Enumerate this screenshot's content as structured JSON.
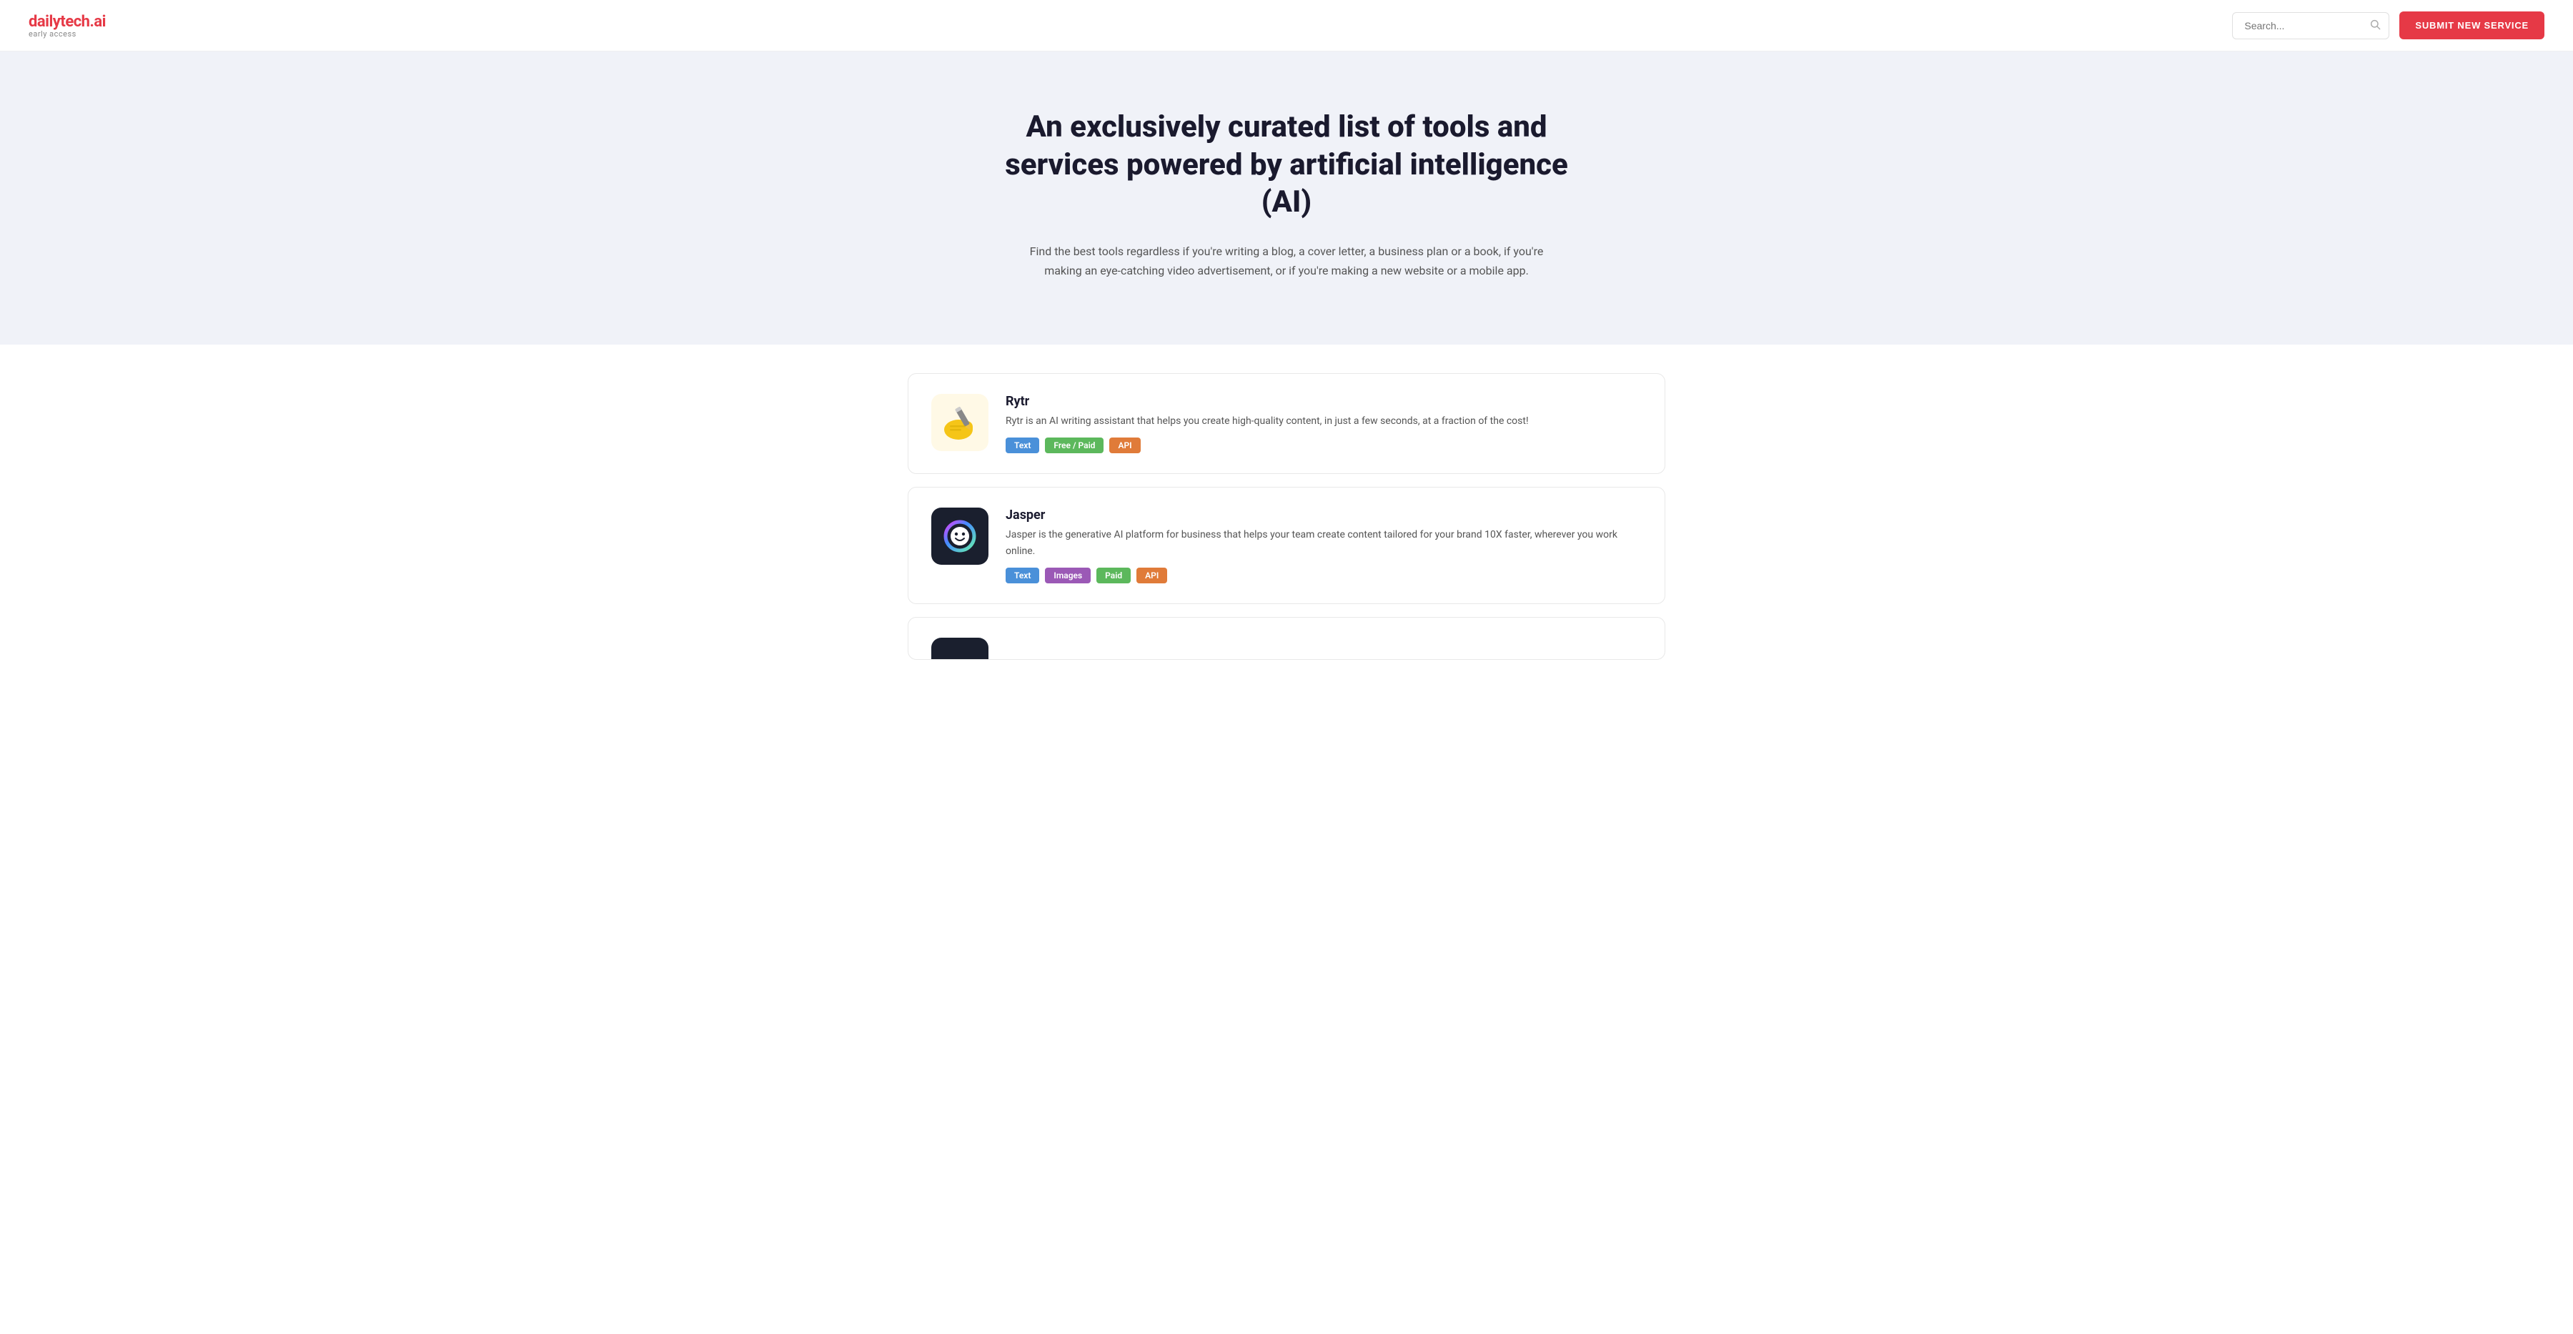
{
  "header": {
    "logo": {
      "brand": "dailytech",
      "accent": ".ai",
      "sub": "early access"
    },
    "search": {
      "placeholder": "Search...",
      "value": ""
    },
    "submit_label": "SUBMIT NEW SERVICE"
  },
  "hero": {
    "title": "An exclusively curated list of tools and services powered by artificial intelligence (AI)",
    "description": "Find the best tools regardless if you're writing a blog, a cover letter, a business plan or a book, if you're making an eye-catching video advertisement, or if you're making a new website or a mobile app."
  },
  "tools": [
    {
      "id": "rytr",
      "name": "Rytr",
      "description": "Rytr is an AI writing assistant that helps you create high-quality content, in just a few seconds, at a fraction of the cost!",
      "tags": [
        {
          "label": "Text",
          "type": "text"
        },
        {
          "label": "Free / Paid",
          "type": "free-paid"
        },
        {
          "label": "API",
          "type": "api"
        }
      ]
    },
    {
      "id": "jasper",
      "name": "Jasper",
      "description": "Jasper is the generative AI platform for business that helps your team create content tailored for your brand 10X faster, wherever you work online.",
      "tags": [
        {
          "label": "Text",
          "type": "text"
        },
        {
          "label": "Images",
          "type": "images"
        },
        {
          "label": "Paid",
          "type": "paid"
        },
        {
          "label": "API",
          "type": "api"
        }
      ]
    },
    {
      "id": "partial",
      "name": "",
      "description": "",
      "tags": []
    }
  ]
}
